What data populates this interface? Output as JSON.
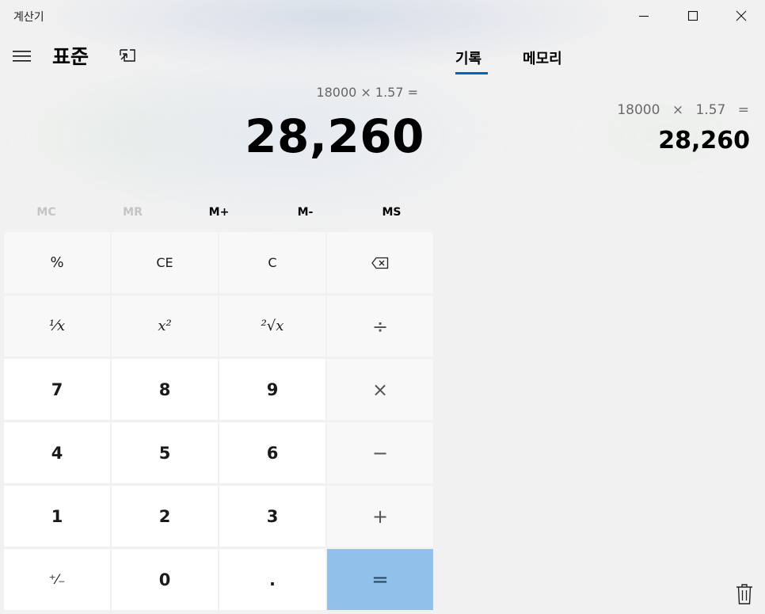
{
  "window": {
    "title": "계산기"
  },
  "header": {
    "mode_title": "표준",
    "tabs": [
      {
        "label": "기록",
        "active": true
      },
      {
        "label": "메모리",
        "active": false
      }
    ]
  },
  "display": {
    "expression": "18000 × 1.57 =",
    "result": "28,260"
  },
  "memory": {
    "buttons": [
      {
        "label": "MC",
        "enabled": false
      },
      {
        "label": "MR",
        "enabled": false
      },
      {
        "label": "M+",
        "enabled": true
      },
      {
        "label": "M-",
        "enabled": true
      },
      {
        "label": "MS",
        "enabled": true
      }
    ]
  },
  "keys": {
    "percent": "%",
    "ce": "CE",
    "c": "C",
    "reciprocal": "¹⁄x",
    "square": "x²",
    "sqrt": "²√x",
    "divide": "÷",
    "seven": "7",
    "eight": "8",
    "nine": "9",
    "multiply": "×",
    "four": "4",
    "five": "5",
    "six": "6",
    "minus": "−",
    "one": "1",
    "two": "2",
    "three": "3",
    "plus": "+",
    "negate": "⁺⁄₋",
    "zero": "0",
    "decimal": ".",
    "equals": "="
  },
  "history": {
    "items": [
      {
        "expression": "18000 × 1.57 =",
        "result": "28,260"
      }
    ]
  },
  "colors": {
    "accent": "#0067c0",
    "equals_key": "#91c1ea"
  },
  "icons": {
    "hamburger": "hamburger-icon",
    "keep_on_top": "keep-on-top-icon",
    "backspace": "backspace-icon",
    "trash": "trash-icon",
    "minimize": "minimize-icon",
    "maximize": "maximize-icon",
    "close": "close-icon"
  }
}
